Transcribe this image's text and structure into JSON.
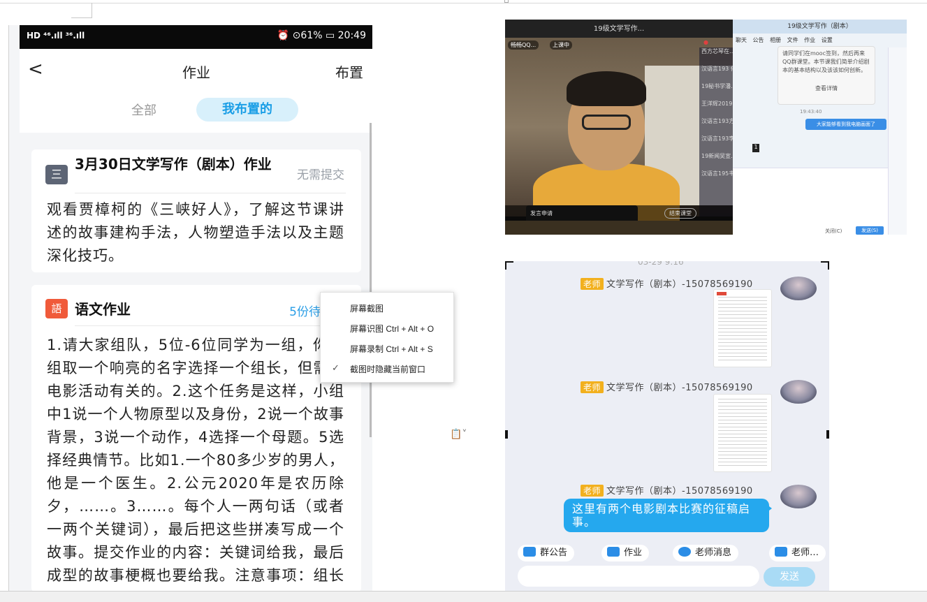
{
  "phone": {
    "status_left": "HD ⁴⁶.ıll ³⁶.ıll",
    "status_right": "⏰ ⊙61% ▭ 20:49",
    "nav": {
      "back": "<",
      "title": "作业",
      "right": "布置"
    },
    "tabs": {
      "all": "全部",
      "mine": "我布置的"
    },
    "cards": [
      {
        "icon": "三",
        "title": "3月30日文学写作（剧本）作业",
        "status": "无需提交",
        "body": "观看贾樟柯的《三峡好人》，了解这节课讲述的故事建构手法，人物塑造手法以及主题深化技巧。"
      },
      {
        "icon": "語",
        "title": "语文作业",
        "status": "5份待批改",
        "body": "1.请大家组队，5位-6位同学为一组，你们组取一个响亮的名字选择一个组长，但需与电影活动有关的。2.这个任务是这样，小组中1说一个人物原型以及身份，2说一个故事背景，3说一个动作，4选择一个母题。5选择经典情节。比如1.一个80多少岁的男人，他是一个医生。2.公元2020年是农历除夕，……。3……。每个人一两句话（或者一两个关键词），最后把这些拼凑写成一个故事。提交作业的内容：关键词给我，最后成型的故事梗概也要给我。注意事项：组长或是不能正相互找..."
      }
    ]
  },
  "context_menu": {
    "items": [
      "屏幕截图",
      "屏幕识图 Ctrl + Alt + O",
      "屏幕录制 Ctrl + Alt + S",
      "截图时隐藏当前窗口"
    ],
    "checked_index": 3
  },
  "video": {
    "title": "19级文学写作...",
    "badge_user": "畅畅QQ...",
    "badge_status": "上课中",
    "controls": {
      "apply": "发言申请",
      "end": "结束课堂"
    },
    "list": [
      "西方芯琴在…",
      "汉语言193 何…",
      "19秘书学潘…",
      "王洋辉2019…",
      "汉语言193方…",
      "汉语言193李…",
      "19新闻吴宣…",
      "汉语言195韦…"
    ],
    "list_count": "1",
    "chat_title": "19级文学写作（剧本）",
    "chat_tabs": "聊天 公告 相册 文件 作业 设置",
    "chat_msg": "请同学们在mooc签到，然后再来QQ群课堂。本节课我们简单介绍剧本的基本结构以及该该如何创新。",
    "chat_link": "查看详情",
    "chat_time": "19:43:40",
    "chat_reply": "大家能够看到我电脑画面了",
    "chat_sender": "19级硕…",
    "chat_badge": "1",
    "chat_close": "关闭(C)",
    "chat_send": "发送(S)"
  },
  "qq": {
    "time": "03-29 9:16",
    "messages": [
      {
        "tag": "老师",
        "sender": "文学写作（剧本）-15078569190"
      },
      {
        "tag": "老师",
        "sender": "文学写作（剧本）-15078569190"
      },
      {
        "tag": "老师",
        "sender": "文学写作（剧本）-15078569190"
      }
    ],
    "bubble_text": "这里有两个电影剧本比赛的征稿启事。",
    "quick_actions": [
      "群公告",
      "作业",
      "老师消息",
      "老师…"
    ],
    "send": "发送"
  },
  "colors": {
    "accent_blue": "#1a9ee6",
    "qq_bubble": "#25a8ee",
    "teacher_tag": "#f2b01e",
    "badge_red": "#f05a3a"
  }
}
